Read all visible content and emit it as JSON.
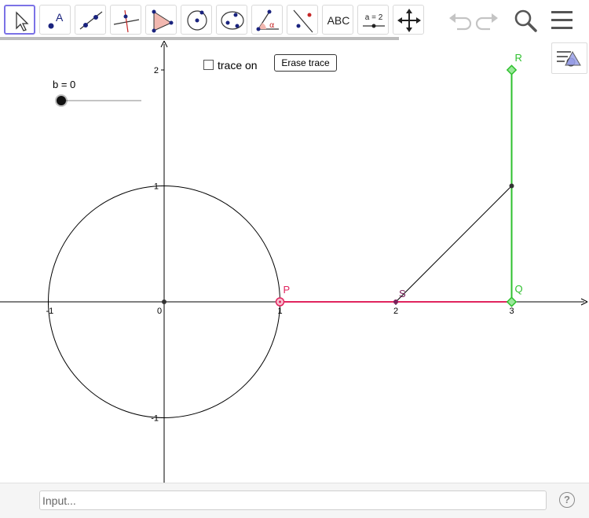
{
  "toolbar": {
    "tools": [
      {
        "name": "move-tool",
        "label": ""
      },
      {
        "name": "point-tool",
        "label": "A"
      },
      {
        "name": "line-tool",
        "label": ""
      },
      {
        "name": "perpendicular-tool",
        "label": ""
      },
      {
        "name": "polygon-tool",
        "label": ""
      },
      {
        "name": "circle-tool",
        "label": ""
      },
      {
        "name": "conic-tool",
        "label": ""
      },
      {
        "name": "angle-tool",
        "label": "α"
      },
      {
        "name": "reflect-tool",
        "label": ""
      },
      {
        "name": "text-tool",
        "label": "ABC"
      },
      {
        "name": "slider-tool",
        "label": "a = 2"
      },
      {
        "name": "move-graphics-tool",
        "label": ""
      }
    ]
  },
  "slider": {
    "label": "b = 0"
  },
  "trace_checkbox": {
    "label": "trace on",
    "checked": false
  },
  "erase_button": {
    "label": "Erase trace"
  },
  "graph": {
    "x_ticks": [
      {
        "value": -1,
        "label": "-1"
      },
      {
        "value": 0,
        "label": "0"
      },
      {
        "value": 1,
        "label": "1"
      },
      {
        "value": 2,
        "label": "2"
      },
      {
        "value": 3,
        "label": "3"
      }
    ],
    "y_ticks": [
      {
        "value": 2,
        "label": "2"
      },
      {
        "value": 1,
        "label": "1"
      },
      {
        "value": -1,
        "label": "-1"
      }
    ],
    "circle": {
      "center": [
        0,
        0
      ],
      "radius": 1
    },
    "points": [
      {
        "label": "P",
        "x": 1,
        "y": 0,
        "color": "#e0245e"
      },
      {
        "label": "S",
        "x": 2,
        "y": 0,
        "color": "#7a1f5a"
      },
      {
        "label": "Q",
        "x": 3,
        "y": 0,
        "color": "#2ec02e"
      },
      {
        "label": "R",
        "x": 3,
        "y": 2,
        "color": "#2ec02e"
      },
      {
        "label": "",
        "x": 3,
        "y": 1,
        "color": "#333333"
      }
    ],
    "colors": {
      "pink_segment": "#e0245e",
      "green_segment": "#2ec02e",
      "axis": "#000000"
    }
  },
  "input_bar": {
    "placeholder": "Input...",
    "value": "",
    "help": "?"
  }
}
